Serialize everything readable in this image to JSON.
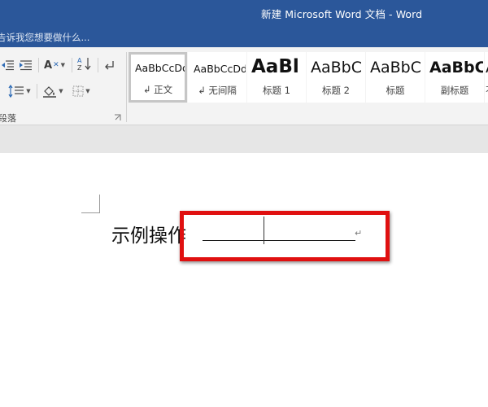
{
  "titlebar": {
    "title": "新建 Microsoft Word 文档 - Word"
  },
  "tellme": {
    "placeholder": "告诉我您想要做什么..."
  },
  "ribbon": {
    "paragraph_group": {
      "label": "段落",
      "tools": [
        {
          "name": "decrease-indent",
          "glyph": "⇤"
        },
        {
          "name": "increase-indent",
          "glyph": "⇥"
        },
        {
          "name": "chinese-layout",
          "glyph": "A"
        },
        {
          "name": "sort",
          "glyph": "A↓Z"
        },
        {
          "name": "show-formatting-marks",
          "glyph": "↵"
        },
        {
          "name": "line-spacing",
          "glyph": "↕"
        },
        {
          "name": "shading",
          "glyph": "◇"
        },
        {
          "name": "borders",
          "glyph": "⊞"
        }
      ]
    },
    "styles": [
      {
        "sample": "AaBbCcDd",
        "name": "↲ 正文",
        "selected": true
      },
      {
        "sample": "AaBbCcDd",
        "name": "↲ 无间隔",
        "selected": false
      },
      {
        "sample": "AaBl",
        "name": "标题 1",
        "selected": false
      },
      {
        "sample": "AaBbC",
        "name": "标题 2",
        "selected": false
      },
      {
        "sample": "AaBbC",
        "name": "标题",
        "selected": false
      },
      {
        "sample": "AaBbC",
        "name": "副标题",
        "selected": false
      },
      {
        "sample": "A",
        "name": "不",
        "selected": false
      }
    ]
  },
  "document": {
    "text": "示例操作",
    "paragraph_mark": "↵"
  },
  "colors": {
    "title_bar": "#2b579a",
    "highlight": "#e01010",
    "ribbon_bg": "#f3f3f3"
  }
}
